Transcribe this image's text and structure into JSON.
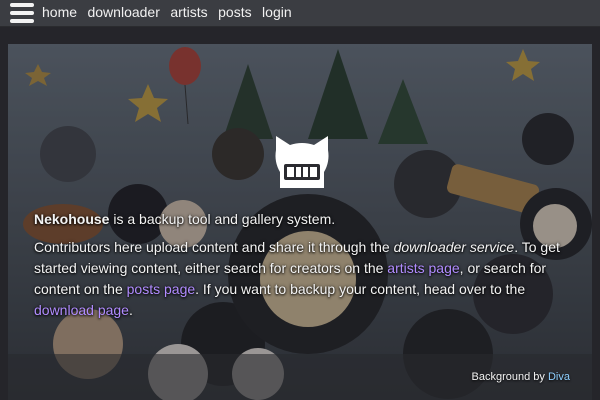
{
  "nav": {
    "menu_icon": "hamburger-menu-icon",
    "links": [
      "home",
      "downloader",
      "artists",
      "posts",
      "login"
    ]
  },
  "hero": {
    "logo_icon": "cat-logo-icon",
    "brand": "Nekohouse",
    "tagline": " is a backup tool and gallery system.",
    "p2_a": "Contributors here upload content and share it through the ",
    "p2_service": "downloader service",
    "p2_b": ". To get started viewing content, either search for creators on the ",
    "p2_artists_link": "artists page",
    "p2_c": ", or search for content on the ",
    "p2_posts_link": "posts page",
    "p2_d": ". If you want to backup your content, head over to the ",
    "p2_download_link": "download page",
    "p2_e": ".",
    "credit_prefix": "Background by ",
    "credit_author": "Diva"
  },
  "colors": {
    "accent_link": "#b18cff",
    "topbar": "#3b3d42"
  }
}
